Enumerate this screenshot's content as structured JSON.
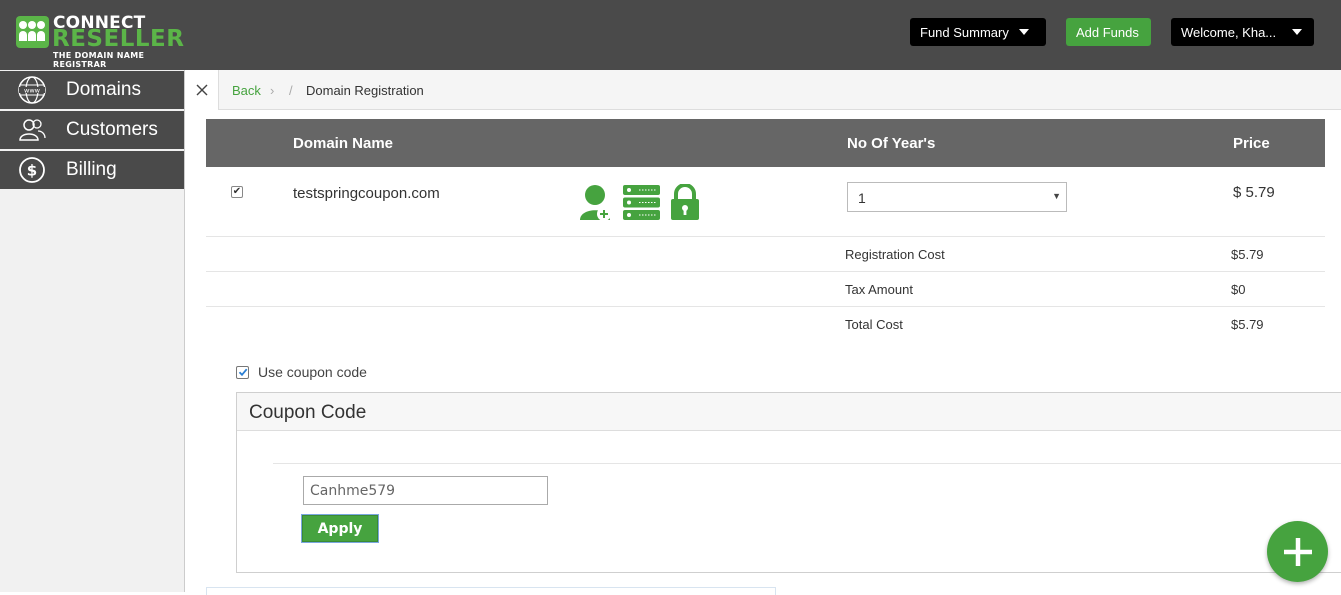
{
  "header": {
    "logo": {
      "line1": "CONNECT",
      "line2": "RESELLER",
      "line3": "THE DOMAIN NAME REGISTRAR"
    },
    "fund_summary_label": "Fund Summary",
    "add_funds_label": "Add Funds",
    "welcome_label": "Welcome, Kha...",
    "colors": {
      "bar": "#4a4a4a",
      "accent": "#46a33f",
      "brand_green": "#5bb548"
    }
  },
  "sidebar": {
    "items": [
      {
        "label": "Domains",
        "icon": "globe-www-icon"
      },
      {
        "label": "Customers",
        "icon": "users-icon"
      },
      {
        "label": "Billing",
        "icon": "dollar-circle-icon"
      }
    ]
  },
  "breadcrumb": {
    "back": "Back",
    "sep1": "›",
    "sep2": "/",
    "current": "Domain Registration"
  },
  "table": {
    "headers": {
      "domain": "Domain Name",
      "years": "No Of Year's",
      "price": "Price"
    },
    "row": {
      "checked": true,
      "domain": "testspringcoupon.com",
      "icons": [
        "add-contact-icon",
        "server-icon",
        "lock-icon"
      ],
      "years": "1",
      "price": "$ 5.79"
    },
    "summary": [
      {
        "label": "Registration Cost",
        "value": "$5.79"
      },
      {
        "label": "Tax Amount",
        "value": "$0"
      },
      {
        "label": "Total Cost",
        "value": "$5.79"
      }
    ]
  },
  "coupon": {
    "use_label": "Use coupon code",
    "use_checked": true,
    "panel_title": "Coupon Code",
    "input_value": "Canhme579",
    "apply_label": "Apply"
  }
}
